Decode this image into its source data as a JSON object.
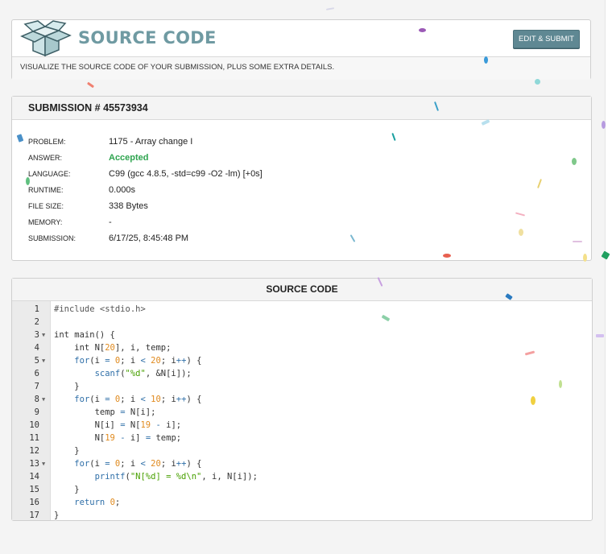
{
  "header": {
    "title": "SOURCE CODE",
    "edit_button": "EDIT & SUBMIT",
    "subtitle": "VISUALIZE THE SOURCE CODE OF YOUR SUBMISSION, PLUS SOME EXTRA DETAILS."
  },
  "submission": {
    "heading": "SUBMISSION # 45573934",
    "rows": [
      {
        "label": "PROBLEM:",
        "value": "1175 - Array change I"
      },
      {
        "label": "ANSWER:",
        "value": "Accepted"
      },
      {
        "label": "LANGUAGE:",
        "value": "C99 (gcc 4.8.5, -std=c99 -O2 -lm) [+0s]"
      },
      {
        "label": "RUNTIME:",
        "value": "0.000s"
      },
      {
        "label": "FILE SIZE:",
        "value": "338 Bytes"
      },
      {
        "label": "MEMORY:",
        "value": "-"
      },
      {
        "label": "SUBMISSION:",
        "value": "6/17/25, 8:45:48 PM"
      }
    ]
  },
  "code": {
    "heading": "SOURCE CODE",
    "lines": [
      {
        "n": "1",
        "fold": false,
        "text": "#include <stdio.h>"
      },
      {
        "n": "2",
        "fold": false,
        "text": ""
      },
      {
        "n": "3",
        "fold": true,
        "text": "int main() {"
      },
      {
        "n": "4",
        "fold": false,
        "text": "    int N[20], i, temp;"
      },
      {
        "n": "5",
        "fold": true,
        "text": "    for(i = 0; i < 20; i++) {"
      },
      {
        "n": "6",
        "fold": false,
        "text": "        scanf(\"%d\", &N[i]);"
      },
      {
        "n": "7",
        "fold": false,
        "text": "    }"
      },
      {
        "n": "8",
        "fold": true,
        "text": "    for(i = 0; i < 10; i++) {"
      },
      {
        "n": "9",
        "fold": false,
        "text": "        temp = N[i];"
      },
      {
        "n": "10",
        "fold": false,
        "text": "        N[i] = N[19 - i];"
      },
      {
        "n": "11",
        "fold": false,
        "text": "        N[19 - i] = temp;"
      },
      {
        "n": "12",
        "fold": false,
        "text": "    }"
      },
      {
        "n": "13",
        "fold": true,
        "text": "    for(i = 0; i < 20; i++) {"
      },
      {
        "n": "14",
        "fold": false,
        "text": "        printf(\"N[%d] = %d\\n\", i, N[i]);"
      },
      {
        "n": "15",
        "fold": false,
        "text": "    }"
      },
      {
        "n": "16",
        "fold": false,
        "text": "    return 0;"
      },
      {
        "n": "17",
        "fold": false,
        "text": "}"
      }
    ]
  },
  "icons": {
    "logo": "open-box-icon",
    "fold": "fold-arrow-icon"
  },
  "colors": {
    "title": "#6f9aa2",
    "button": "#5f8893",
    "accepted": "#2ea44f",
    "keyword": "#2f6fa8",
    "number": "#e08a1e",
    "string": "#48a000"
  }
}
